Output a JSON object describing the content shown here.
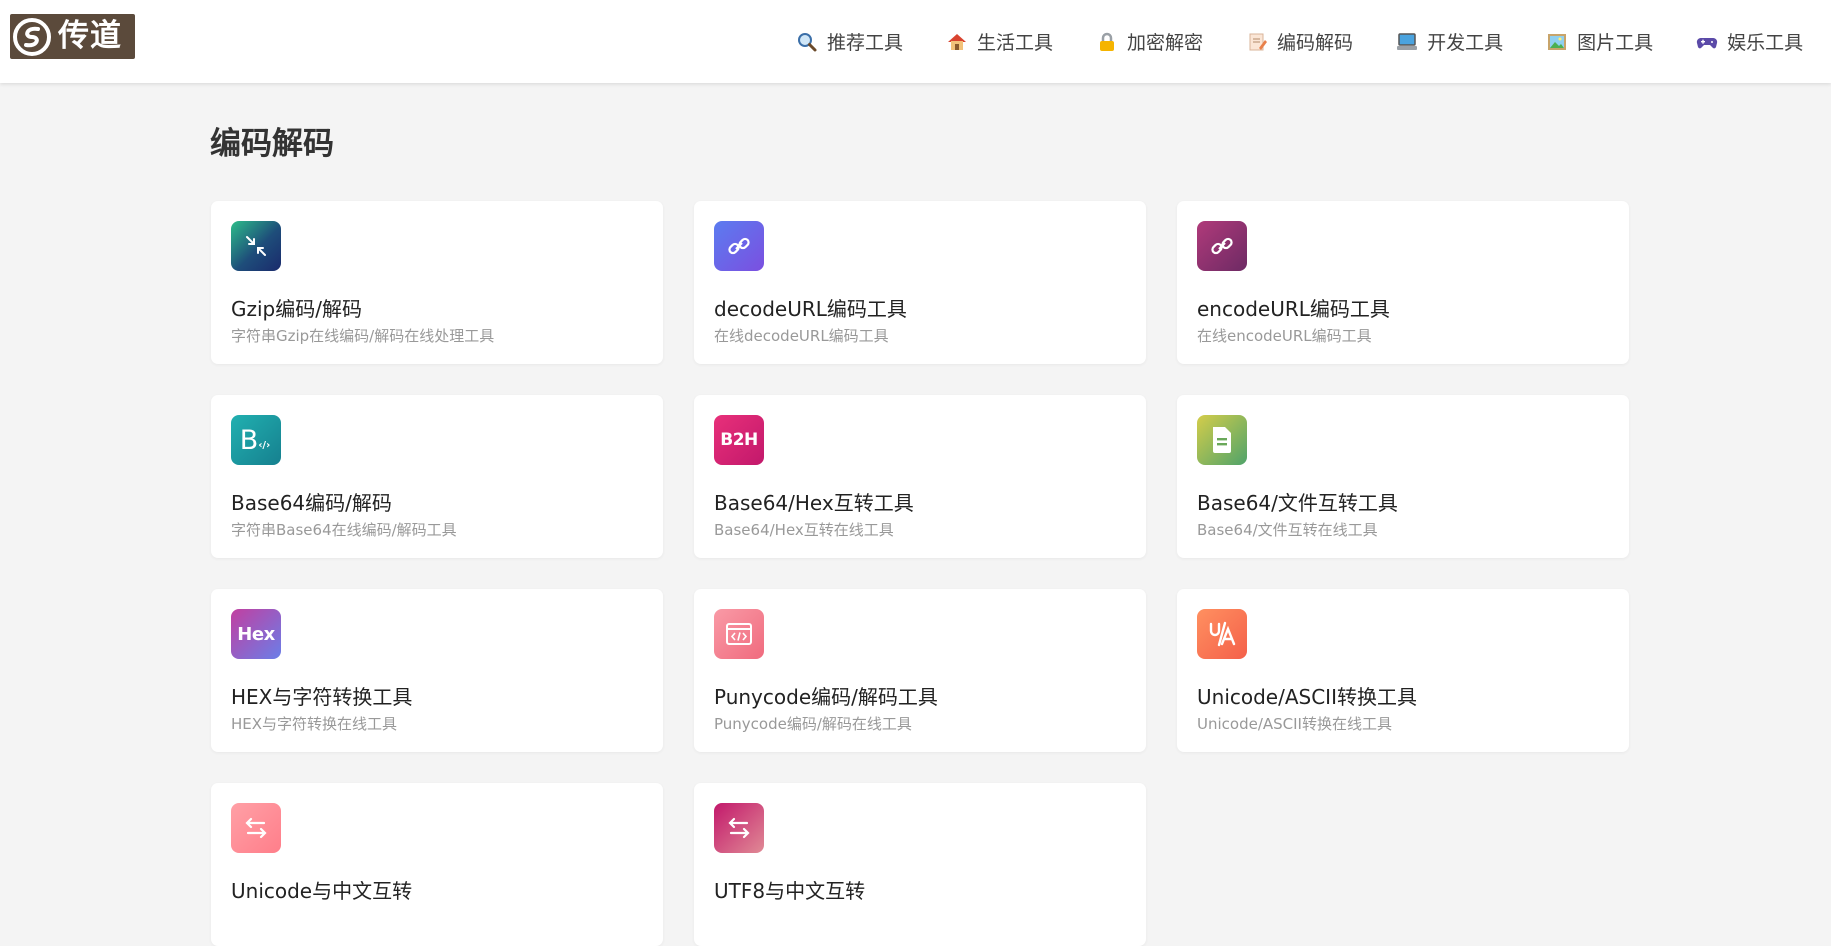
{
  "site": {
    "logo_text": "传道"
  },
  "nav": {
    "items": [
      {
        "label": "推荐工具",
        "icon": "magnifier-icon"
      },
      {
        "label": "生活工具",
        "icon": "house-icon"
      },
      {
        "label": "加密解密",
        "icon": "lock-icon"
      },
      {
        "label": "编码解码",
        "icon": "memo-icon"
      },
      {
        "label": "开发工具",
        "icon": "computer-icon"
      },
      {
        "label": "图片工具",
        "icon": "picture-icon"
      },
      {
        "label": "娱乐工具",
        "icon": "gamepad-icon"
      }
    ]
  },
  "page": {
    "title": "编码解码"
  },
  "tools": [
    {
      "title": "Gzip编码/解码",
      "desc": "字符串Gzip在线编码/解码在线处理工具",
      "icon": "compress-arrows-icon",
      "icon_text": "",
      "colors": [
        "#2dbd8a",
        "#1a2a6c"
      ]
    },
    {
      "title": "decodeURL编码工具",
      "desc": "在线decodeURL编码工具",
      "icon": "link-icon",
      "icon_text": "",
      "colors": [
        "#6a6ff0",
        "#7b4fe0"
      ]
    },
    {
      "title": "encodeURL编码工具",
      "desc": "在线encodeURL编码工具",
      "icon": "link-icon",
      "icon_text": "",
      "colors": [
        "#b03a7a",
        "#7a2a6a"
      ]
    },
    {
      "title": "Base64编码/解码",
      "desc": "字符串Base64在线编码/解码工具",
      "icon": "base64-code-icon",
      "icon_text": "B",
      "colors": [
        "#1fa7a7",
        "#16808f"
      ]
    },
    {
      "title": "Base64/Hex互转工具",
      "desc": "Base64/Hex互转在线工具",
      "icon": "b2h-icon",
      "icon_text": "B2H",
      "colors": [
        "#e8307a",
        "#c2186b"
      ]
    },
    {
      "title": "Base64/文件互转工具",
      "desc": "Base64/文件互转在线工具",
      "icon": "file-icon",
      "icon_text": "",
      "colors": [
        "#d4cd4a",
        "#4fa36a"
      ]
    },
    {
      "title": "HEX与字符转换工具",
      "desc": "HEX与字符转换在线工具",
      "icon": "hex-icon",
      "icon_text": "Hex",
      "colors": [
        "#c23fa0",
        "#6a7ee8"
      ]
    },
    {
      "title": "Punycode编码/解码工具",
      "desc": "Punycode编码/解码在线工具",
      "icon": "code-window-icon",
      "icon_text": "",
      "colors": [
        "#f78a9a",
        "#f06b7e"
      ]
    },
    {
      "title": "Unicode/ASCII转换工具",
      "desc": "Unicode/ASCII转换在线工具",
      "icon": "translate-icon",
      "icon_text": "",
      "colors": [
        "#ff8a5c",
        "#f56b4c"
      ]
    },
    {
      "title": "Unicode与中文互转",
      "desc": "",
      "icon": "swap-arrows-icon",
      "icon_text": "",
      "colors": [
        "#ff9a9e",
        "#ff7e8a"
      ]
    },
    {
      "title": "UTF8与中文互转",
      "desc": "",
      "icon": "swap-arrows-icon",
      "icon_text": "",
      "colors": [
        "#c2186b",
        "#e07a8a"
      ]
    }
  ]
}
